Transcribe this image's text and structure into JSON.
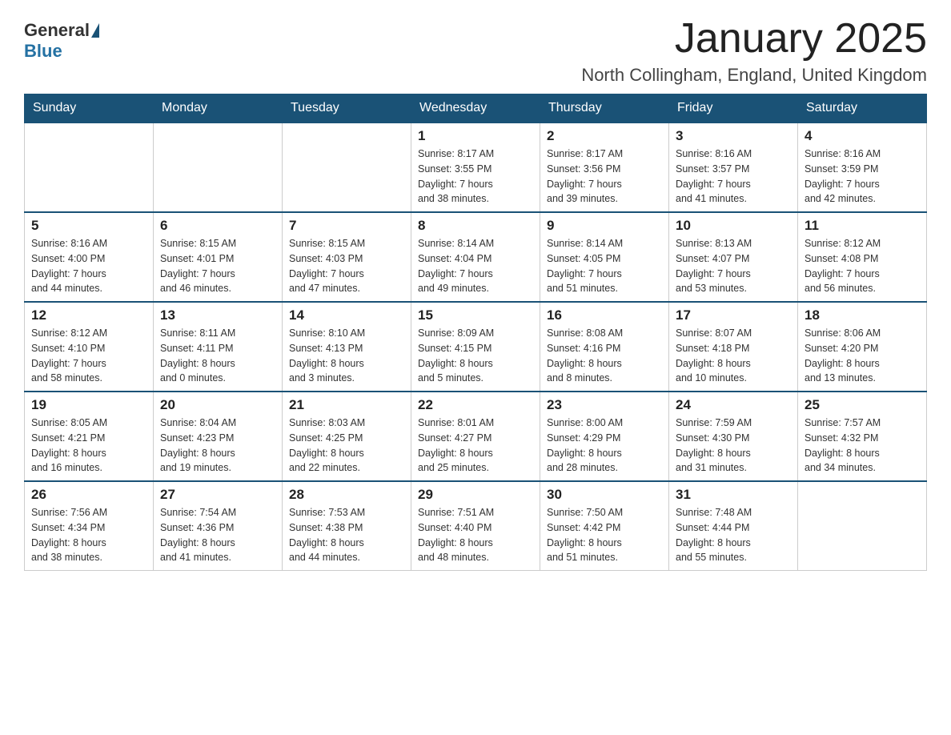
{
  "header": {
    "logo_general": "General",
    "logo_blue": "Blue",
    "title": "January 2025",
    "subtitle": "North Collingham, England, United Kingdom"
  },
  "days_of_week": [
    "Sunday",
    "Monday",
    "Tuesday",
    "Wednesday",
    "Thursday",
    "Friday",
    "Saturday"
  ],
  "weeks": [
    [
      {
        "day": "",
        "info": ""
      },
      {
        "day": "",
        "info": ""
      },
      {
        "day": "",
        "info": ""
      },
      {
        "day": "1",
        "info": "Sunrise: 8:17 AM\nSunset: 3:55 PM\nDaylight: 7 hours\nand 38 minutes."
      },
      {
        "day": "2",
        "info": "Sunrise: 8:17 AM\nSunset: 3:56 PM\nDaylight: 7 hours\nand 39 minutes."
      },
      {
        "day": "3",
        "info": "Sunrise: 8:16 AM\nSunset: 3:57 PM\nDaylight: 7 hours\nand 41 minutes."
      },
      {
        "day": "4",
        "info": "Sunrise: 8:16 AM\nSunset: 3:59 PM\nDaylight: 7 hours\nand 42 minutes."
      }
    ],
    [
      {
        "day": "5",
        "info": "Sunrise: 8:16 AM\nSunset: 4:00 PM\nDaylight: 7 hours\nand 44 minutes."
      },
      {
        "day": "6",
        "info": "Sunrise: 8:15 AM\nSunset: 4:01 PM\nDaylight: 7 hours\nand 46 minutes."
      },
      {
        "day": "7",
        "info": "Sunrise: 8:15 AM\nSunset: 4:03 PM\nDaylight: 7 hours\nand 47 minutes."
      },
      {
        "day": "8",
        "info": "Sunrise: 8:14 AM\nSunset: 4:04 PM\nDaylight: 7 hours\nand 49 minutes."
      },
      {
        "day": "9",
        "info": "Sunrise: 8:14 AM\nSunset: 4:05 PM\nDaylight: 7 hours\nand 51 minutes."
      },
      {
        "day": "10",
        "info": "Sunrise: 8:13 AM\nSunset: 4:07 PM\nDaylight: 7 hours\nand 53 minutes."
      },
      {
        "day": "11",
        "info": "Sunrise: 8:12 AM\nSunset: 4:08 PM\nDaylight: 7 hours\nand 56 minutes."
      }
    ],
    [
      {
        "day": "12",
        "info": "Sunrise: 8:12 AM\nSunset: 4:10 PM\nDaylight: 7 hours\nand 58 minutes."
      },
      {
        "day": "13",
        "info": "Sunrise: 8:11 AM\nSunset: 4:11 PM\nDaylight: 8 hours\nand 0 minutes."
      },
      {
        "day": "14",
        "info": "Sunrise: 8:10 AM\nSunset: 4:13 PM\nDaylight: 8 hours\nand 3 minutes."
      },
      {
        "day": "15",
        "info": "Sunrise: 8:09 AM\nSunset: 4:15 PM\nDaylight: 8 hours\nand 5 minutes."
      },
      {
        "day": "16",
        "info": "Sunrise: 8:08 AM\nSunset: 4:16 PM\nDaylight: 8 hours\nand 8 minutes."
      },
      {
        "day": "17",
        "info": "Sunrise: 8:07 AM\nSunset: 4:18 PM\nDaylight: 8 hours\nand 10 minutes."
      },
      {
        "day": "18",
        "info": "Sunrise: 8:06 AM\nSunset: 4:20 PM\nDaylight: 8 hours\nand 13 minutes."
      }
    ],
    [
      {
        "day": "19",
        "info": "Sunrise: 8:05 AM\nSunset: 4:21 PM\nDaylight: 8 hours\nand 16 minutes."
      },
      {
        "day": "20",
        "info": "Sunrise: 8:04 AM\nSunset: 4:23 PM\nDaylight: 8 hours\nand 19 minutes."
      },
      {
        "day": "21",
        "info": "Sunrise: 8:03 AM\nSunset: 4:25 PM\nDaylight: 8 hours\nand 22 minutes."
      },
      {
        "day": "22",
        "info": "Sunrise: 8:01 AM\nSunset: 4:27 PM\nDaylight: 8 hours\nand 25 minutes."
      },
      {
        "day": "23",
        "info": "Sunrise: 8:00 AM\nSunset: 4:29 PM\nDaylight: 8 hours\nand 28 minutes."
      },
      {
        "day": "24",
        "info": "Sunrise: 7:59 AM\nSunset: 4:30 PM\nDaylight: 8 hours\nand 31 minutes."
      },
      {
        "day": "25",
        "info": "Sunrise: 7:57 AM\nSunset: 4:32 PM\nDaylight: 8 hours\nand 34 minutes."
      }
    ],
    [
      {
        "day": "26",
        "info": "Sunrise: 7:56 AM\nSunset: 4:34 PM\nDaylight: 8 hours\nand 38 minutes."
      },
      {
        "day": "27",
        "info": "Sunrise: 7:54 AM\nSunset: 4:36 PM\nDaylight: 8 hours\nand 41 minutes."
      },
      {
        "day": "28",
        "info": "Sunrise: 7:53 AM\nSunset: 4:38 PM\nDaylight: 8 hours\nand 44 minutes."
      },
      {
        "day": "29",
        "info": "Sunrise: 7:51 AM\nSunset: 4:40 PM\nDaylight: 8 hours\nand 48 minutes."
      },
      {
        "day": "30",
        "info": "Sunrise: 7:50 AM\nSunset: 4:42 PM\nDaylight: 8 hours\nand 51 minutes."
      },
      {
        "day": "31",
        "info": "Sunrise: 7:48 AM\nSunset: 4:44 PM\nDaylight: 8 hours\nand 55 minutes."
      },
      {
        "day": "",
        "info": ""
      }
    ]
  ]
}
